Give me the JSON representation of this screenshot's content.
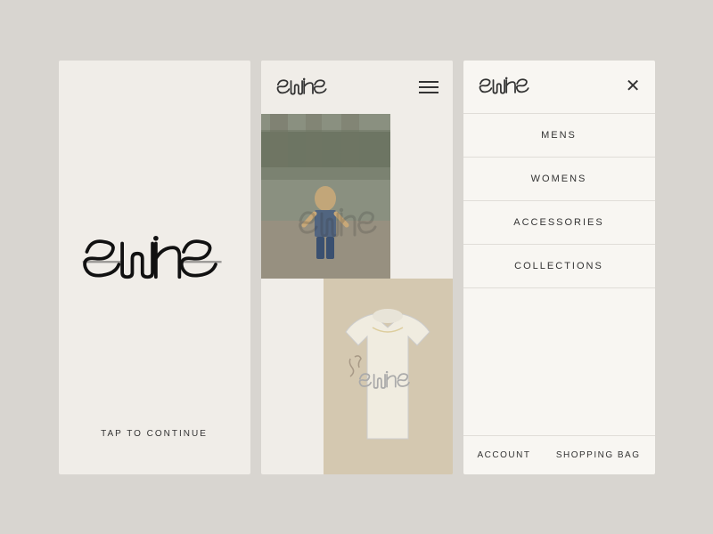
{
  "splash": {
    "tap_label": "TAP TO CONTINUE"
  },
  "header": {
    "logo_alt": "Stussy Logo"
  },
  "menu": {
    "items": [
      {
        "label": "MENS",
        "id": "mens"
      },
      {
        "label": "WOMENS",
        "id": "womens"
      },
      {
        "label": "ACCESSORIES",
        "id": "accessories"
      },
      {
        "label": "COLLECTIONS",
        "id": "collections"
      }
    ],
    "footer": {
      "account": "ACCOUNT",
      "shopping_bag": "SHOPPING BAG"
    }
  },
  "icons": {
    "hamburger": "≡",
    "close": "×"
  }
}
